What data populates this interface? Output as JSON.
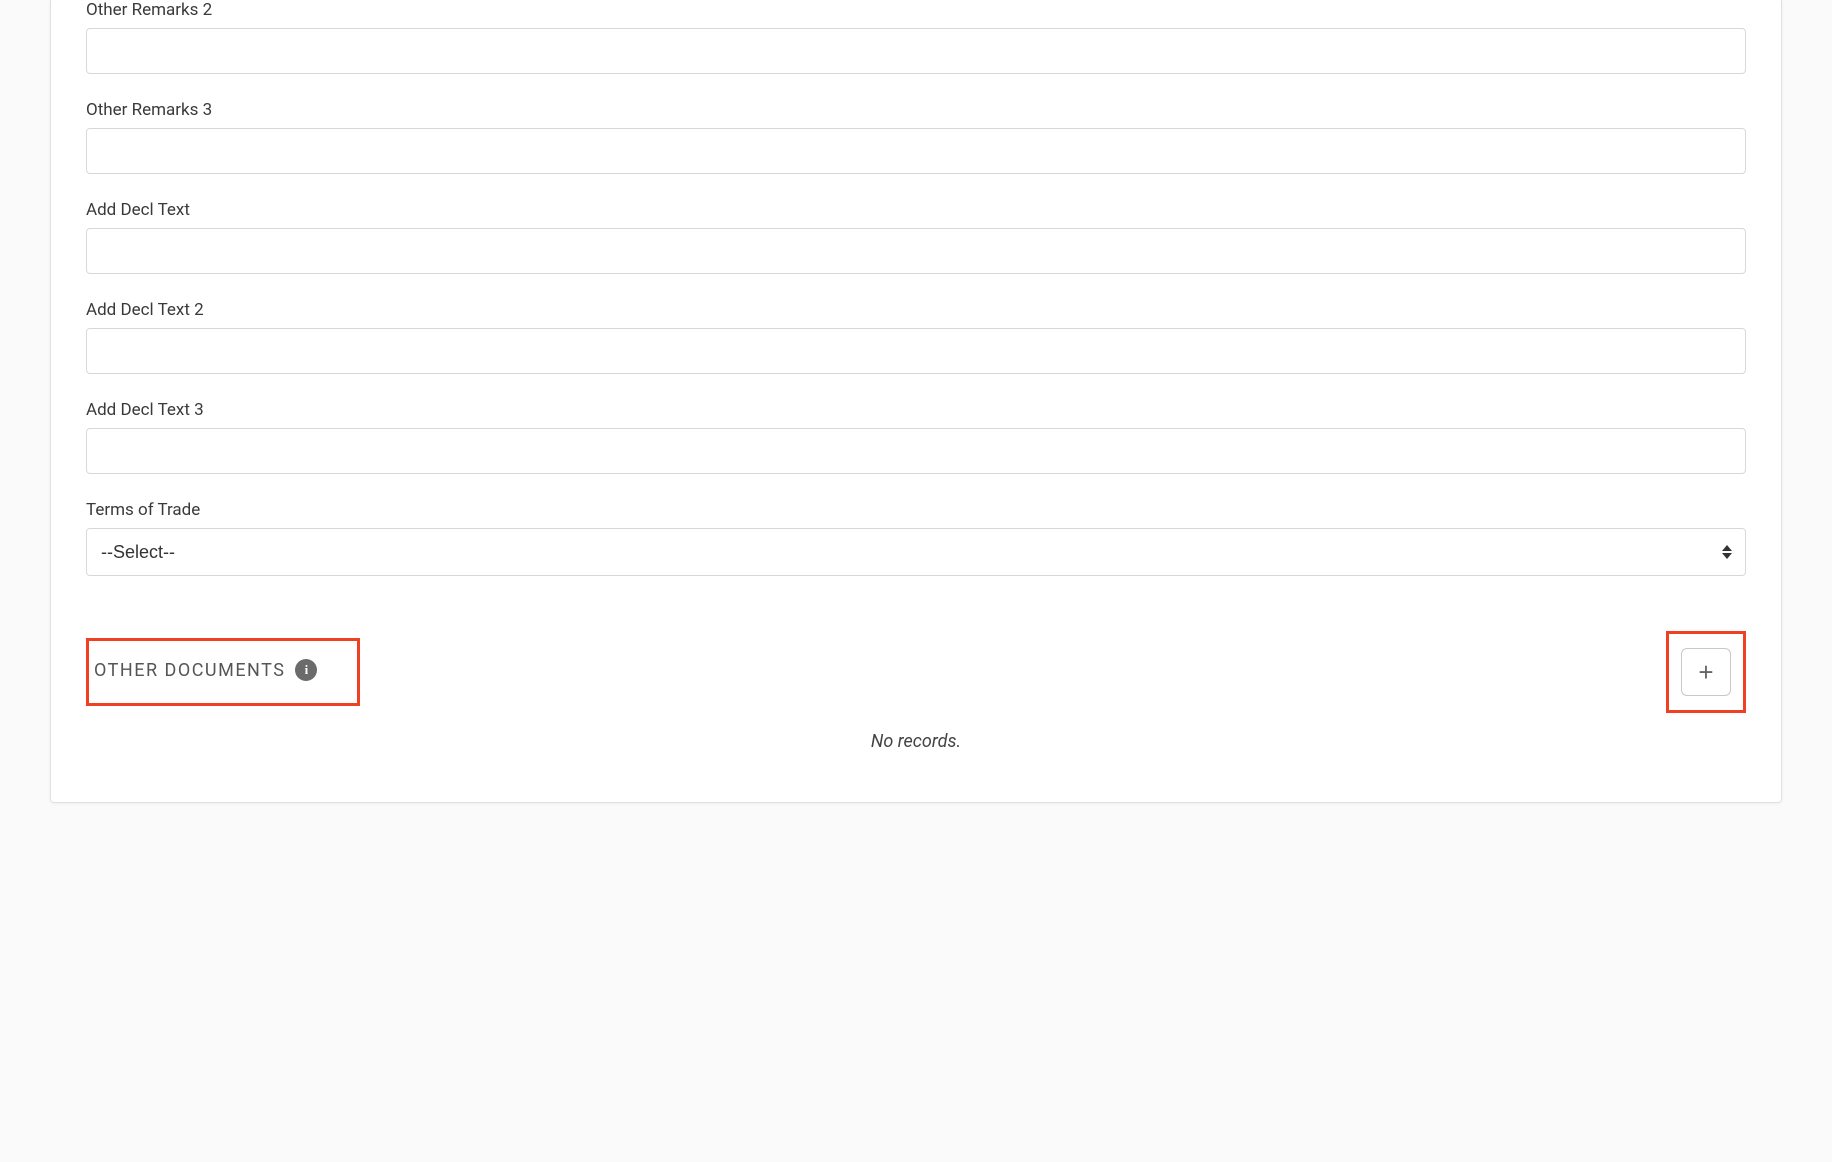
{
  "fields": {
    "other_remarks_2": {
      "label": "Other Remarks 2",
      "value": ""
    },
    "other_remarks_3": {
      "label": "Other Remarks 3",
      "value": ""
    },
    "add_decl_text": {
      "label": "Add Decl Text",
      "value": ""
    },
    "add_decl_text_2": {
      "label": "Add Decl Text 2",
      "value": ""
    },
    "add_decl_text_3": {
      "label": "Add Decl Text 3",
      "value": ""
    },
    "terms_of_trade": {
      "label": "Terms of Trade",
      "selected": "--Select--"
    }
  },
  "section": {
    "other_documents": {
      "title": "OTHER DOCUMENTS",
      "info_glyph": "i",
      "add_glyph": "+",
      "empty_text": "No records."
    }
  }
}
